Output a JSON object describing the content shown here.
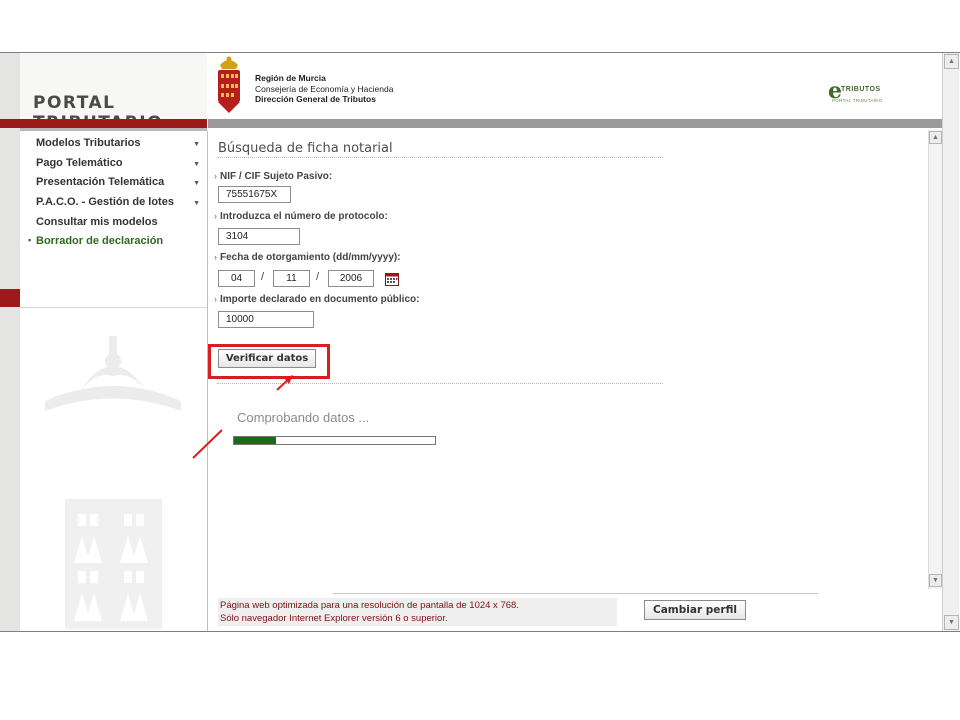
{
  "sidebar": {
    "portal_title": "PORTAL TRIBUTARIO",
    "items": [
      {
        "label": "Modelos Tributarios",
        "has_submenu": true
      },
      {
        "label": "Pago Telemático",
        "has_submenu": true
      },
      {
        "label": "Presentación Telemática",
        "has_submenu": true
      },
      {
        "label": "P.A.C.O. - Gestión de lotes",
        "has_submenu": true
      },
      {
        "label": "Consultar mis modelos",
        "has_submenu": false
      },
      {
        "label": "Borrador de declaración",
        "has_submenu": false,
        "active": true
      }
    ]
  },
  "header": {
    "org_line1": "Región de Murcia",
    "org_line2": "Consejería de Economía y Hacienda",
    "org_line3": "Dirección General de Tributos",
    "brand_logo": "e-tributos-logo",
    "brand_text": "TRIBUTOS",
    "brand_subtext": "PORTAL TRIBUTARIO"
  },
  "form": {
    "title": "Búsqueda de ficha notarial",
    "nif_label": "NIF / CIF Sujeto Pasivo:",
    "nif_value": "75551675X",
    "protocol_label": "Introduzca el número de protocolo:",
    "protocol_value": "3104",
    "date_label": "Fecha de otorgamiento (dd/mm/yyyy):",
    "date_day": "04",
    "date_month": "11",
    "date_year": "2006",
    "date_separator": "/",
    "amount_label": "Importe declarado en documento público:",
    "amount_value": "10000",
    "verify_button": "Verificar datos",
    "status_text": "Comprobando datos ...",
    "progress": 0.21
  },
  "footer": {
    "note_line1": "Página web optimizada para una resolución de pantalla de 1024 x 768.",
    "note_line2": "Sólo navegador Internet Explorer versión 6 o superior.",
    "change_profile_button": "Cambiar perfil"
  },
  "colors": {
    "brand_red": "#9b1b1b",
    "highlight_red": "#d91e1e",
    "progress_green": "#1b6a1b",
    "active_green": "#2d6a1c",
    "footer_text": "#7d1010"
  },
  "icons": {
    "calendar": "calendar-icon",
    "crest": "murcia-crest-icon",
    "submenu": "chevron-down-icon"
  }
}
